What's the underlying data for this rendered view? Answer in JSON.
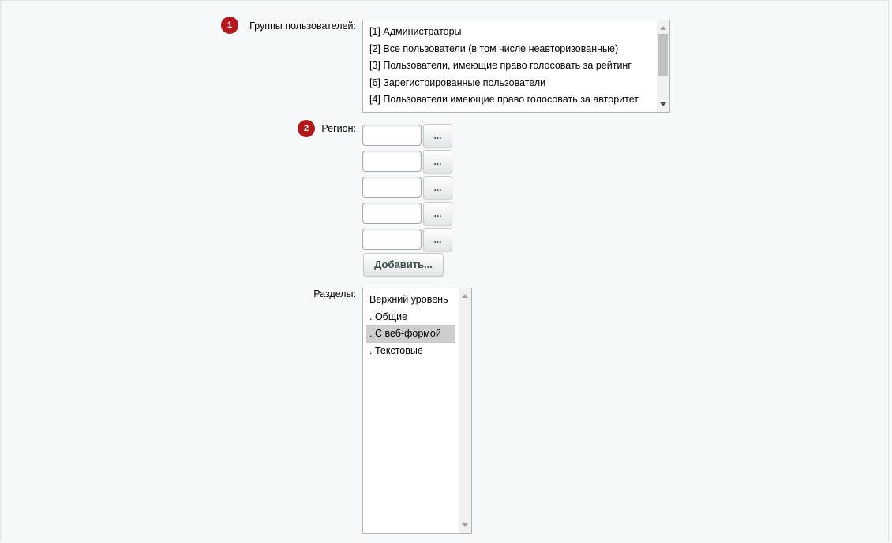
{
  "user_groups": {
    "step": "1",
    "label": "Группы пользователей:",
    "options": [
      "[1] Администраторы",
      "[2] Все пользователи (в том числе неавторизованные)",
      "[3] Пользователи, имеющие право голосовать за рейтинг",
      "[6] Зарегистрированные пользователи",
      "[4] Пользователи имеющие право голосовать за авторитет"
    ]
  },
  "region": {
    "step": "2",
    "label": "Регион:",
    "inputs": [
      "",
      "",
      "",
      "",
      ""
    ],
    "browse_label": "...",
    "add_label": "Добавить..."
  },
  "sections": {
    "label": "Разделы:",
    "options": [
      "Верхний уровень",
      ". Общие",
      ". С веб-формой",
      ". Текстовые"
    ],
    "selected": ". С веб-формой"
  }
}
